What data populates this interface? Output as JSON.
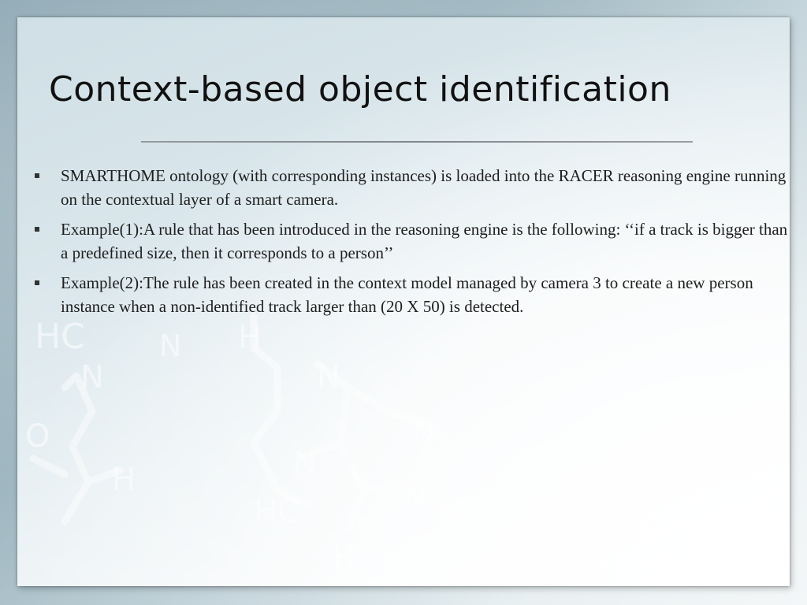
{
  "slide": {
    "title": "Context-based object identification",
    "bullets": [
      "SMARTHOME ontology (with corresponding instances) is loaded into the RACER reasoning engine running on the contextual layer of a smart camera.",
      "Example(1):A rule that has been introduced in the reasoning engine is the following: ‘‘if a track is bigger than a predefined size, then it corresponds to a person’’",
      "Example(2):The rule has been created in the context model managed by camera 3 to create a new person instance when a non-identified track larger than (20 X 50) is detected."
    ]
  },
  "colors": {
    "title_text": "#111111",
    "body_text": "#1e1e1e",
    "background_blue": "#8aa5b1",
    "panel_white": "#ffffff"
  },
  "icons": {
    "bullet": "square-bullet-icon",
    "background_art": "chemical-structure-watermark"
  }
}
